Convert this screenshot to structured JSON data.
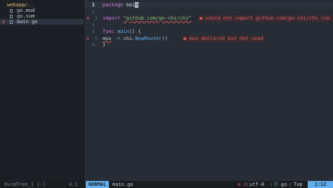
{
  "tree": {
    "root": "webapp/..",
    "files": [
      {
        "name": "go.mod",
        "error": false
      },
      {
        "name": "go.sum",
        "error": false
      },
      {
        "name": "main.go",
        "error": true
      }
    ],
    "error_sign": "⊗"
  },
  "editor": {
    "lines": [
      {
        "num": "1",
        "tokens": [
          {
            "t": "package ",
            "c": "kw"
          },
          {
            "t": "mai",
            "c": "id"
          },
          {
            "t": "n",
            "c": "cursor"
          }
        ],
        "current": true
      },
      {
        "num": "1"
      },
      {
        "num": "2",
        "tokens": [
          {
            "t": "import ",
            "c": "kw"
          },
          {
            "t": "\"github.com/go-chi/chi\"",
            "c": "str undercurl"
          }
        ],
        "sign": "⊗",
        "diag": "● could not import github.com/go-chi/chi (no requ"
      },
      {
        "num": "3"
      },
      {
        "num": "4",
        "tokens": [
          {
            "t": "func ",
            "c": "kw"
          },
          {
            "t": "main",
            "c": "fn"
          },
          {
            "t": "() {",
            "c": "id"
          }
        ]
      },
      {
        "num": "5",
        "tokens": [
          {
            "t": "  ",
            "c": "id"
          },
          {
            "t": "mux",
            "c": "id undercurl"
          },
          {
            "t": " := ",
            "c": "op"
          },
          {
            "t": "chi",
            "c": "id"
          },
          {
            "t": ".",
            "c": "id"
          },
          {
            "t": "NewRouter",
            "c": "fn"
          },
          {
            "t": "()",
            "c": "id"
          }
        ],
        "sign": "⊗",
        "diag": "● mux declared but not used"
      },
      {
        "num": "6",
        "tokens": [
          {
            "t": "}",
            "c": "id"
          }
        ]
      }
    ]
  },
  "status": {
    "tree_name": "NvimTree_1 [-]",
    "tree_pos": "4:1",
    "mode": "NORMAL",
    "file": "main.go",
    "errors": "⊗ 2",
    "sep": "❮",
    "encoding": "utf-8",
    "filetype_icon": "🖹",
    "filetype": "go",
    "scroll": "Top",
    "position": "1:12"
  }
}
